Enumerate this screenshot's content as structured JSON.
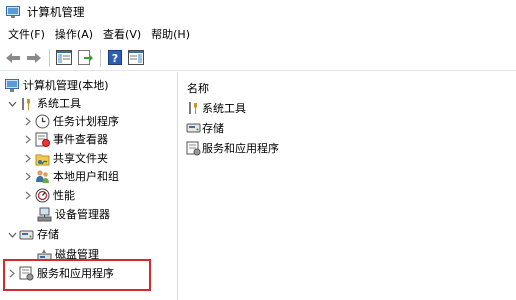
{
  "window": {
    "title": "计算机管理"
  },
  "menu": [
    "文件(F)",
    "操作(A)",
    "查看(V)",
    "帮助(H)"
  ],
  "tree": {
    "root": "计算机管理(本地)",
    "system_tools": "系统工具",
    "task_scheduler": "任务计划程序",
    "event_viewer": "事件查看器",
    "shared_folders": "共享文件夹",
    "local_users": "本地用户和组",
    "performance": "性能",
    "device_manager": "设备管理器",
    "storage": "存储",
    "disk_management": "磁盘管理",
    "services_apps": "服务和应用程序"
  },
  "details": {
    "column_name": "名称",
    "items": [
      "系统工具",
      "存储",
      "服务和应用程序"
    ]
  },
  "colors": {
    "highlight_border": "#d22b2b",
    "tool_icon": "#3a6ea5"
  }
}
